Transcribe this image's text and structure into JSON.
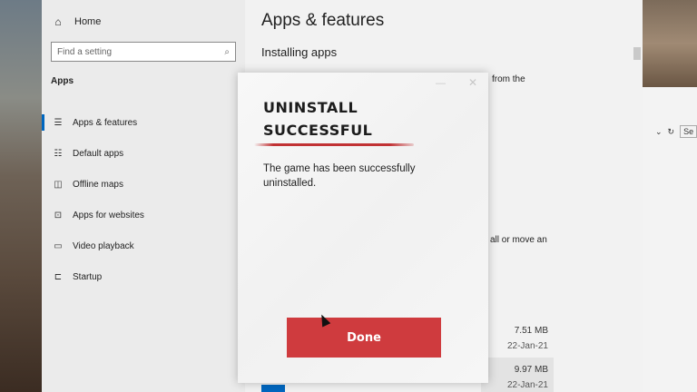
{
  "sidebar": {
    "home_label": "Home",
    "search_placeholder": "Find a setting",
    "section_title": "Apps",
    "items": [
      {
        "label": "Apps & features",
        "icon": "list-icon"
      },
      {
        "label": "Default apps",
        "icon": "default-apps-icon"
      },
      {
        "label": "Offline maps",
        "icon": "map-icon"
      },
      {
        "label": "Apps for websites",
        "icon": "link-box-icon"
      },
      {
        "label": "Video playback",
        "icon": "video-icon"
      },
      {
        "label": "Startup",
        "icon": "startup-icon"
      }
    ]
  },
  "content": {
    "title": "Apps & features",
    "subtitle": "Installing apps",
    "fragment_1": "from the",
    "fragment_2": "all or move an",
    "apps": [
      {
        "size": "7.51 MB",
        "date": "22-Jan-21"
      },
      {
        "size": "9.97 MB",
        "date": "22-Jan-21"
      }
    ]
  },
  "background_window": {
    "search_fragment": "Se"
  },
  "dialog": {
    "title_line1": "UNINSTALL",
    "title_line2": "SUCCESSFUL",
    "message": "The game has been successfully uninstalled.",
    "done_label": "Done",
    "accent_color": "#cf3b3e"
  }
}
